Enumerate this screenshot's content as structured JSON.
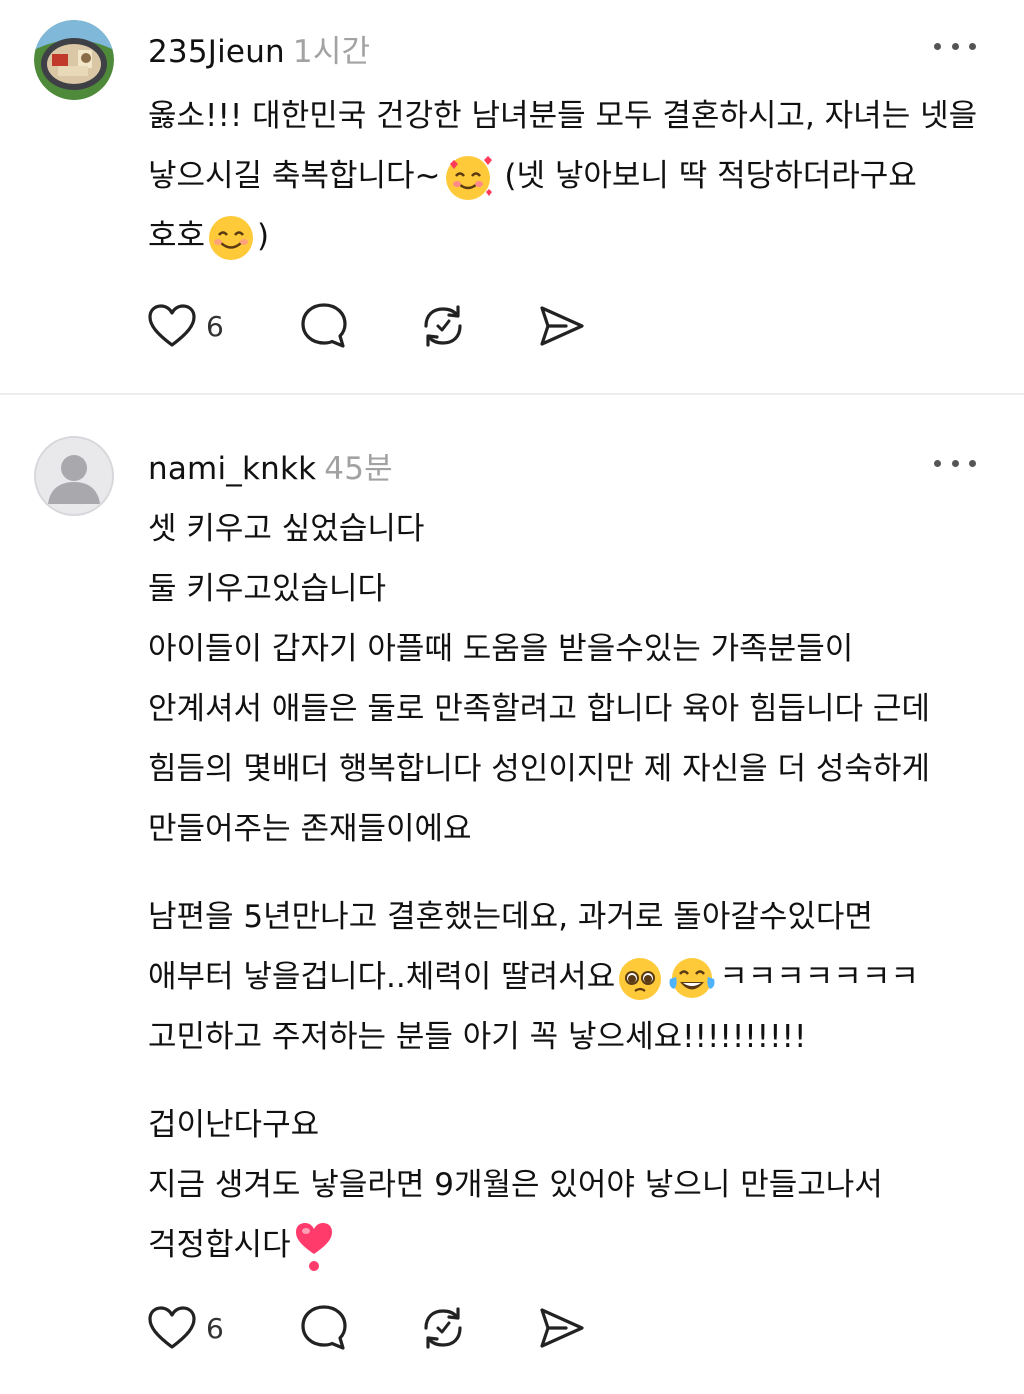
{
  "comments": [
    {
      "username": "235Jieun",
      "time": "1시간",
      "lines": [
        [
          "옳소!!! 대한민국 건강한 남녀분들 모두 결혼하시고, 자녀는 넷을"
        ],
        [
          "낳으시길 축복합니다~",
          "(넷 낳아보니 딱 적당하더라구요"
        ],
        [
          "호호",
          ")"
        ]
      ],
      "like_count": "6"
    },
    {
      "username": "nami_knkk",
      "time": "45분",
      "paragraph1": [
        "셋 키우고 싶었습니다",
        "둘 키우고있습니다",
        "아이들이 갑자기 아플때 도움을 받을수있는 가족분들이",
        "안계셔서 애들은 둘로 만족할려고 합니다 육아 힘듭니다 근데",
        "힘듬의 몇배더 행복합니다 성인이지만 제 자신을 더 성숙하게",
        "만들어주는 존재들이에요"
      ],
      "paragraph2": [
        "남편을 5년만나고 결혼했는데요, 과거로 돌아갈수있다면",
        [
          "애부터 낳을겁니다..체력이 딸려서요",
          "ㅋㅋㅋㅋㅋㅋㅋ"
        ],
        "고민하고 주저하는 분들 아기 꼭 낳으세요!!!!!!!!!!"
      ],
      "paragraph3": [
        "겁이난다구요",
        "지금 생겨도 낳을라면 9개월은 있어야 낳으니 만들고나서",
        "걱정합시다"
      ],
      "like_count": "6"
    }
  ],
  "icons": {
    "like": "heart-icon",
    "reply": "comment-bubble-icon",
    "repost": "repost-icon",
    "share": "send-icon",
    "more": "more-dots-icon",
    "emoji_hearts": "smiling-face-with-hearts-emoji",
    "emoji_smile": "smiling-face-emoji",
    "emoji_pleading": "pleading-face-emoji",
    "emoji_joy": "tears-of-joy-emoji",
    "emoji_heart": "heart-exclamation-emoji"
  }
}
